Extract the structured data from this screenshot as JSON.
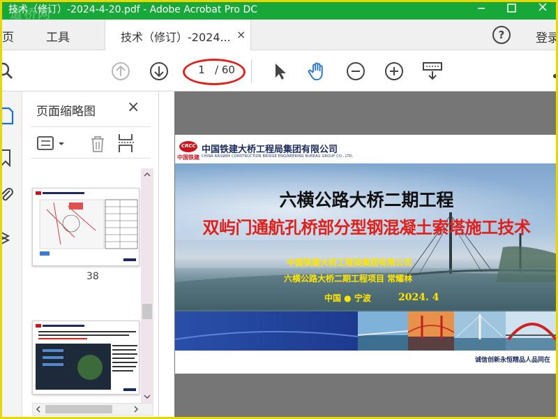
{
  "window": {
    "title": "技术（修订）-2024-4-20.pdf - Adobe Acrobat Pro DC",
    "watermark": "道桥网"
  },
  "tabs": {
    "home": "主页",
    "tools": "工具",
    "document": "技术（修订）-2024...",
    "close_glyph": "×",
    "login": "登录",
    "help_glyph": "?"
  },
  "toolbar": {
    "current_page": "1",
    "total_pages": "/ 60"
  },
  "thumbnail_panel": {
    "title": "页面缩略图",
    "close_glyph": "×",
    "page_numbers": [
      "38"
    ]
  },
  "slide": {
    "company_cn": "中国铁建大桥工程局集团有限公司",
    "company_en": "CHINA RAILWAY CONSTRUCTION BRIDGE ENGINEERING BUREAU GROUP CO., LTD.",
    "logo_text": "CRCC",
    "logo_sub": "中国铁建",
    "title": "六横公路大桥二期工程",
    "subtitle": "双屿门通航孔桥部分型钢混凝土索塔施工技术",
    "org_line": "中国铁建大桥工程局集团有限公司",
    "project_line": "六横公路大桥二期工程项目 常耀林",
    "location": "中国 ● 宁波",
    "date": "2024. 4",
    "slogan_left": "诚信创新永恒",
    "slogan_right": "精品人品同在"
  },
  "colors": {
    "titlebar": "#18a83a",
    "accent_red": "#e0201a",
    "highlight_yellow": "#ffe600",
    "brand_navy": "#1b2a5c"
  }
}
